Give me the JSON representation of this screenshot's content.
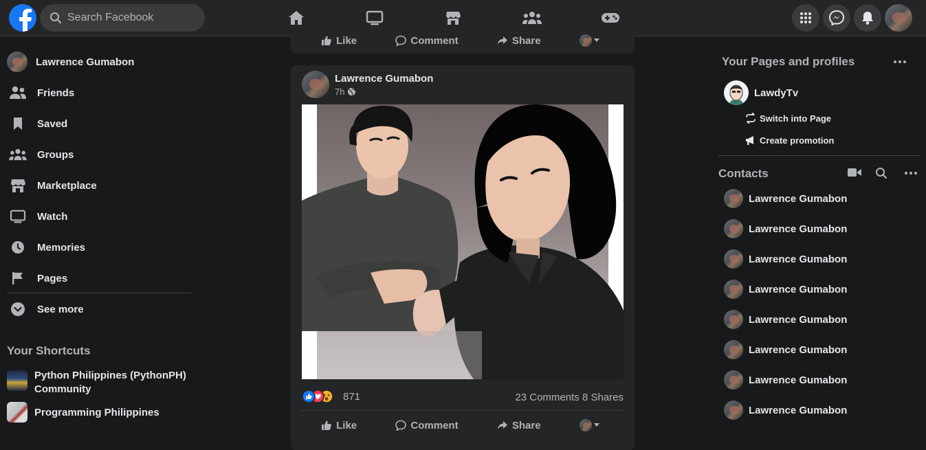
{
  "topbar": {
    "search_placeholder": "Search Facebook",
    "logo": "facebook-logo",
    "nav_icons": [
      "home-icon",
      "watch-icon",
      "marketplace-icon",
      "groups-icon",
      "gaming-icon"
    ],
    "right_icons": [
      "menu-grid-icon",
      "messenger-icon",
      "bell-icon"
    ]
  },
  "left_sidebar": {
    "profile_name": "Lawrence Gumabon",
    "items": [
      {
        "label": "Friends",
        "icon": "friends-icon"
      },
      {
        "label": "Saved",
        "icon": "bookmark-icon"
      },
      {
        "label": "Groups",
        "icon": "groups-icon"
      },
      {
        "label": "Marketplace",
        "icon": "marketplace-icon"
      },
      {
        "label": "Watch",
        "icon": "watch-icon"
      },
      {
        "label": "Memories",
        "icon": "clock-icon"
      },
      {
        "label": "Pages",
        "icon": "flag-icon"
      },
      {
        "label": "See more",
        "icon": "chevron-down-icon"
      }
    ],
    "shortcuts_title": "Your Shortcuts",
    "shortcuts": [
      {
        "label": "Python Philippines (PythonPH) Community"
      },
      {
        "label": "Programming Philippines"
      }
    ]
  },
  "feed": {
    "actions": {
      "like": "Like",
      "comment": "Comment",
      "share": "Share"
    },
    "post": {
      "author": "Lawrence Gumabon",
      "time": "7h",
      "reaction_count": "871",
      "comments": "23 Comments",
      "shares": "8 Shares"
    }
  },
  "right_sidebar": {
    "pages_title": "Your Pages and profiles",
    "page_name": "LawdyTv",
    "switch_label": "Switch into Page",
    "promotion_label": "Create promotion",
    "contacts_title": "Contacts",
    "contacts": [
      "Lawrence Gumabon",
      "Lawrence Gumabon",
      "Lawrence Gumabon",
      "Lawrence Gumabon",
      "Lawrence Gumabon",
      "Lawrence Gumabon",
      "Lawrence Gumabon",
      "Lawrence Gumabon"
    ]
  },
  "colors": {
    "background": "#18191a",
    "surface": "#242526",
    "accent": "#1877f2",
    "text_primary": "#e4e6eb",
    "text_secondary": "#b0b3b8"
  }
}
